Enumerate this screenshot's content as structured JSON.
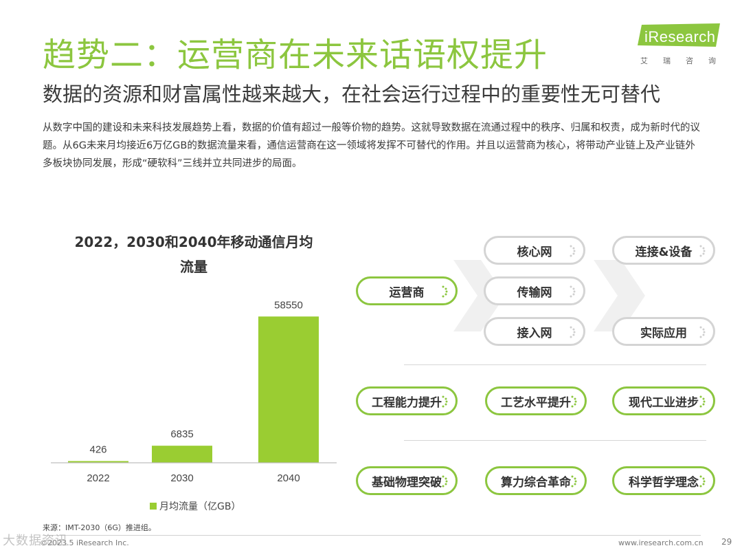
{
  "header": {
    "title": "趋势二：运营商在未来话语权提升",
    "subtitle": "数据的资源和财富属性越来越大，在社会运行过程中的重要性无可替代",
    "body": "从数字中国的建设和未来科技发展趋势上看，数据的价值有超过一般等价物的趋势。这就导致数据在流通过程中的秩序、归属和权责，成为新时代的议题。从6G未来月均接近6万亿GB的数据流量来看，通信运营商在这一领域将发挥不可替代的作用。并且以运营商为核心，将带动产业链上及产业链外多板块协同发展，形成“硬软科”三线并立共同进步的局面。"
  },
  "logo": {
    "text": "iResearch",
    "sub": "艾瑞咨询"
  },
  "chart_data": {
    "type": "bar",
    "title_line1": "2022，2030和2040年移动通信月均",
    "title_line2": "流量",
    "categories": [
      "2022",
      "2030",
      "2040"
    ],
    "values": [
      426,
      6835,
      58550
    ],
    "value_labels": [
      "426",
      "6835",
      "58550"
    ],
    "series": [
      {
        "name": "月均流量（亿GB）",
        "values": [
          426,
          6835,
          58550
        ]
      }
    ],
    "ylim": [
      0,
      60000
    ],
    "bar_color": "#9acd32",
    "grid": false,
    "legend_position": "bottom-center"
  },
  "diagram": {
    "center": "运营商",
    "middle": [
      "核心网",
      "传输网",
      "接入网"
    ],
    "right": [
      "连接&设备",
      "实际应用"
    ],
    "row_hardware": [
      "工程能力提升",
      "工艺水平提升",
      "现代工业进步"
    ],
    "row_science": [
      "基础物理突破",
      "算力综合革命",
      "科学哲学理念"
    ]
  },
  "footer": {
    "source": "来源：IMT-2030（6G）推进组。",
    "copyright": "©2023.5 iResearch Inc.",
    "website": "www.iresearch.com.cn",
    "page": "29",
    "watermark": "大数据资讯"
  },
  "colors": {
    "accent": "#8cc63f",
    "bar": "#9acd32",
    "pill_border": "#d4d4d4",
    "arrow": "#f0f0f0"
  }
}
